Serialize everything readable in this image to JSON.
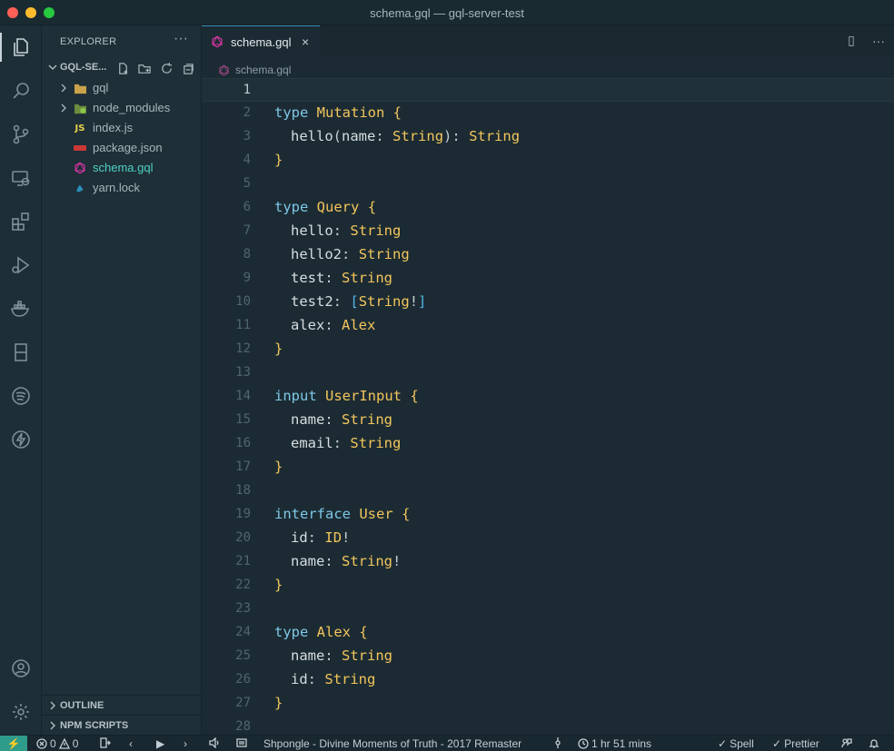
{
  "window": {
    "title": "schema.gql — gql-server-test"
  },
  "sidebar": {
    "header": "EXPLORER",
    "more": "···",
    "folder_name": "GQL-SE...",
    "items": [
      {
        "label": "gql",
        "type": "folder"
      },
      {
        "label": "node_modules",
        "type": "folder"
      },
      {
        "label": "index.js",
        "type": "js"
      },
      {
        "label": "package.json",
        "type": "npm"
      },
      {
        "label": "schema.gql",
        "type": "graphql",
        "selected": true
      },
      {
        "label": "yarn.lock",
        "type": "yarn"
      }
    ],
    "outline_label": "OUTLINE",
    "npm_scripts_label": "NPM SCRIPTS"
  },
  "tabs": [
    {
      "label": "schema.gql",
      "close": "×"
    }
  ],
  "tab_actions": {
    "split": "▯",
    "more": "···"
  },
  "breadcrumb": {
    "file": "schema.gql"
  },
  "code": {
    "lines": [
      {
        "n": "1",
        "text": ""
      },
      {
        "n": "2",
        "text": "type Mutation {"
      },
      {
        "n": "3",
        "text": "hello(name: String): String"
      },
      {
        "n": "4",
        "text": "}"
      },
      {
        "n": "5",
        "text": ""
      },
      {
        "n": "6",
        "text": "type Query {"
      },
      {
        "n": "7",
        "text": "hello: String"
      },
      {
        "n": "8",
        "text": "hello2: String"
      },
      {
        "n": "9",
        "text": "test: String"
      },
      {
        "n": "10",
        "text": "test2: [String!]"
      },
      {
        "n": "11",
        "text": "alex: Alex"
      },
      {
        "n": "12",
        "text": "}"
      },
      {
        "n": "13",
        "text": ""
      },
      {
        "n": "14",
        "text": "input UserInput {"
      },
      {
        "n": "15",
        "text": "name: String"
      },
      {
        "n": "16",
        "text": "email: String"
      },
      {
        "n": "17",
        "text": "}"
      },
      {
        "n": "18",
        "text": ""
      },
      {
        "n": "19",
        "text": "interface User {"
      },
      {
        "n": "20",
        "text": "id: ID!"
      },
      {
        "n": "21",
        "text": "name: String!"
      },
      {
        "n": "22",
        "text": "}"
      },
      {
        "n": "23",
        "text": ""
      },
      {
        "n": "24",
        "text": "type Alex {"
      },
      {
        "n": "25",
        "text": "name: String"
      },
      {
        "n": "26",
        "text": "id: String"
      },
      {
        "n": "27",
        "text": "}"
      },
      {
        "n": "28",
        "text": ""
      }
    ]
  },
  "status": {
    "remote": "⚡",
    "errors": "0",
    "warnings": "0",
    "prev": "‹",
    "play": "▶",
    "next": "›",
    "song": "Shpongle - Divine Moments of Truth - 2017 Remaster",
    "time": "1 hr 51 mins",
    "spell": "Spell",
    "prettier": "Prettier"
  },
  "colors": {
    "accent": "#4fd1c5",
    "keyword": "#7ec7e8",
    "type": "#f2c55c",
    "remote_bg": "#2f9b8a"
  }
}
